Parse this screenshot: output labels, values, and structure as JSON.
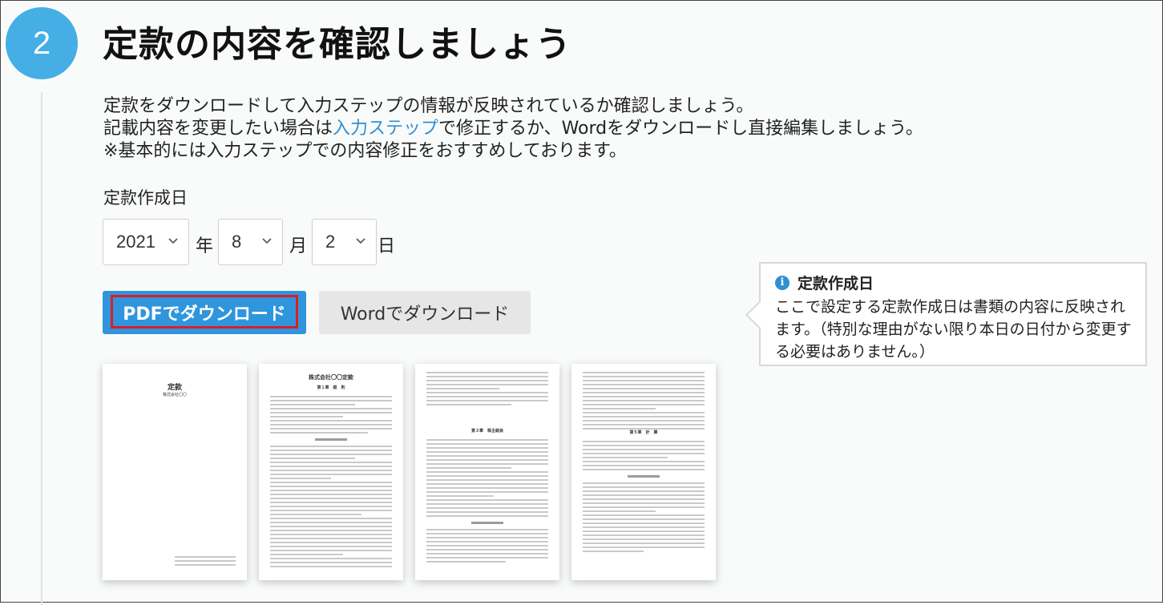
{
  "step": {
    "number": "2",
    "title": "定款の内容を確認しましょう"
  },
  "description": {
    "line1": "定款をダウンロードして入力ステップの情報が反映されているか確認しましょう。",
    "line2_prefix": "記載内容を変更したい場合は",
    "line2_link": "入力ステップ",
    "line2_suffix": "で修正するか、Wordをダウンロードし直接編集しましょう。",
    "line3": "※基本的には入力ステップでの内容修正をおすすめしております。"
  },
  "date": {
    "label": "定款作成日",
    "year": "2021",
    "year_unit": "年",
    "month": "8",
    "month_unit": "月",
    "day": "2",
    "day_unit": "日"
  },
  "buttons": {
    "pdf": "PDFでダウンロード",
    "word": "Wordでダウンロード"
  },
  "tooltip": {
    "title": "定款作成日",
    "body": "ここで設定する定款作成日は書類の内容に反映されます。（特別な理由がない限り本日の日付から変更する必要はありません。）"
  },
  "thumbnails": [
    {
      "title": "定款",
      "subtitle": "株式会社〇〇"
    },
    {
      "title": "株式会社〇〇定款",
      "subtitle": "第１章　総　則"
    },
    {
      "title": "",
      "subtitle": "第３章　株主総会"
    },
    {
      "title": "",
      "subtitle": "第５章　計　算"
    }
  ],
  "colors": {
    "accent": "#45aee4",
    "primary_button": "#2f95dc",
    "highlight": "#e01b24",
    "link": "#2f8fd0"
  }
}
